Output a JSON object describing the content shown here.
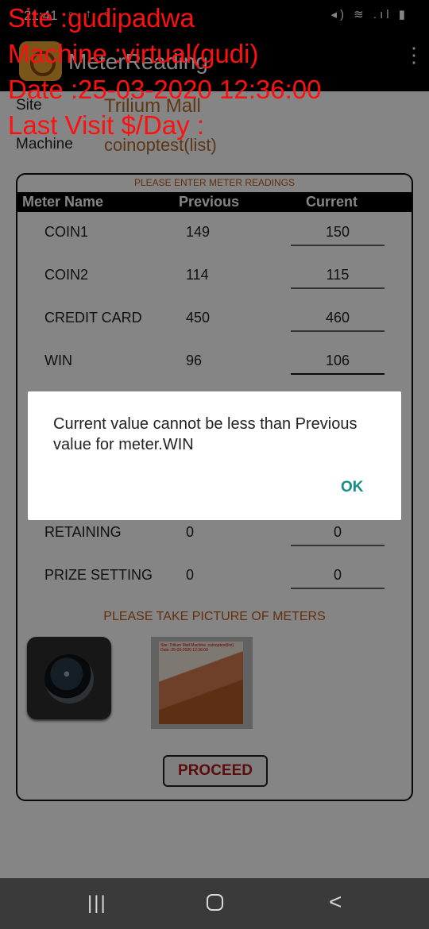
{
  "status_bar": {
    "time": "21:41",
    "left_icons": "▫ ↑ ▫",
    "right_icons": "◂) ≋ .ıl ▮"
  },
  "app_bar": {
    "title": "MeterReading",
    "logo_icon": "app-logo-icon",
    "menu_icon": "more-vert-icon"
  },
  "info": {
    "site_label": "Site",
    "site_value": "Trilium Mall",
    "machine_label": "Machine",
    "machine_value": "coinoptest(list)"
  },
  "panel": {
    "heading": "PLEASE ENTER METER READINGS",
    "columns": {
      "name": "Meter Name",
      "previous": "Previous",
      "current": "Current"
    },
    "meters": [
      {
        "name": "COIN1",
        "previous": "149",
        "current": "150"
      },
      {
        "name": "COIN2",
        "previous": "114",
        "current": "115"
      },
      {
        "name": "CREDIT CARD",
        "previous": "450",
        "current": "460"
      },
      {
        "name": "WIN",
        "previous": "96",
        "current": "106"
      },
      {
        "name": "RETAINING",
        "previous": "0",
        "current": "0"
      },
      {
        "name": "PRIZE SETTING",
        "previous": "0",
        "current": "0"
      }
    ],
    "picture_heading": "PLEASE TAKE PICTURE OF METERS",
    "photo_stamp": "Site :Trilium Mall Machine :coinoptest(list) Date :25-03-2020 12:36:00",
    "proceed_label": "PROCEED"
  },
  "dialog": {
    "message": "Current value cannot be less than Previous value for meter.WIN",
    "ok_label": "OK"
  },
  "nav_bar": {
    "recents": "|||",
    "back": "<"
  },
  "overlay": {
    "site": "Site :gudipadwa",
    "machine": "Machine :virtual(gudi)",
    "date": "Date :25-03-2020 12:36:00",
    "last_visit": "Last Visit $/Day :"
  },
  "colors": {
    "accent": "#148f85",
    "label_orange": "#c05a1a",
    "overlay_red": "#ff1010",
    "proceed_red": "#b01818"
  }
}
